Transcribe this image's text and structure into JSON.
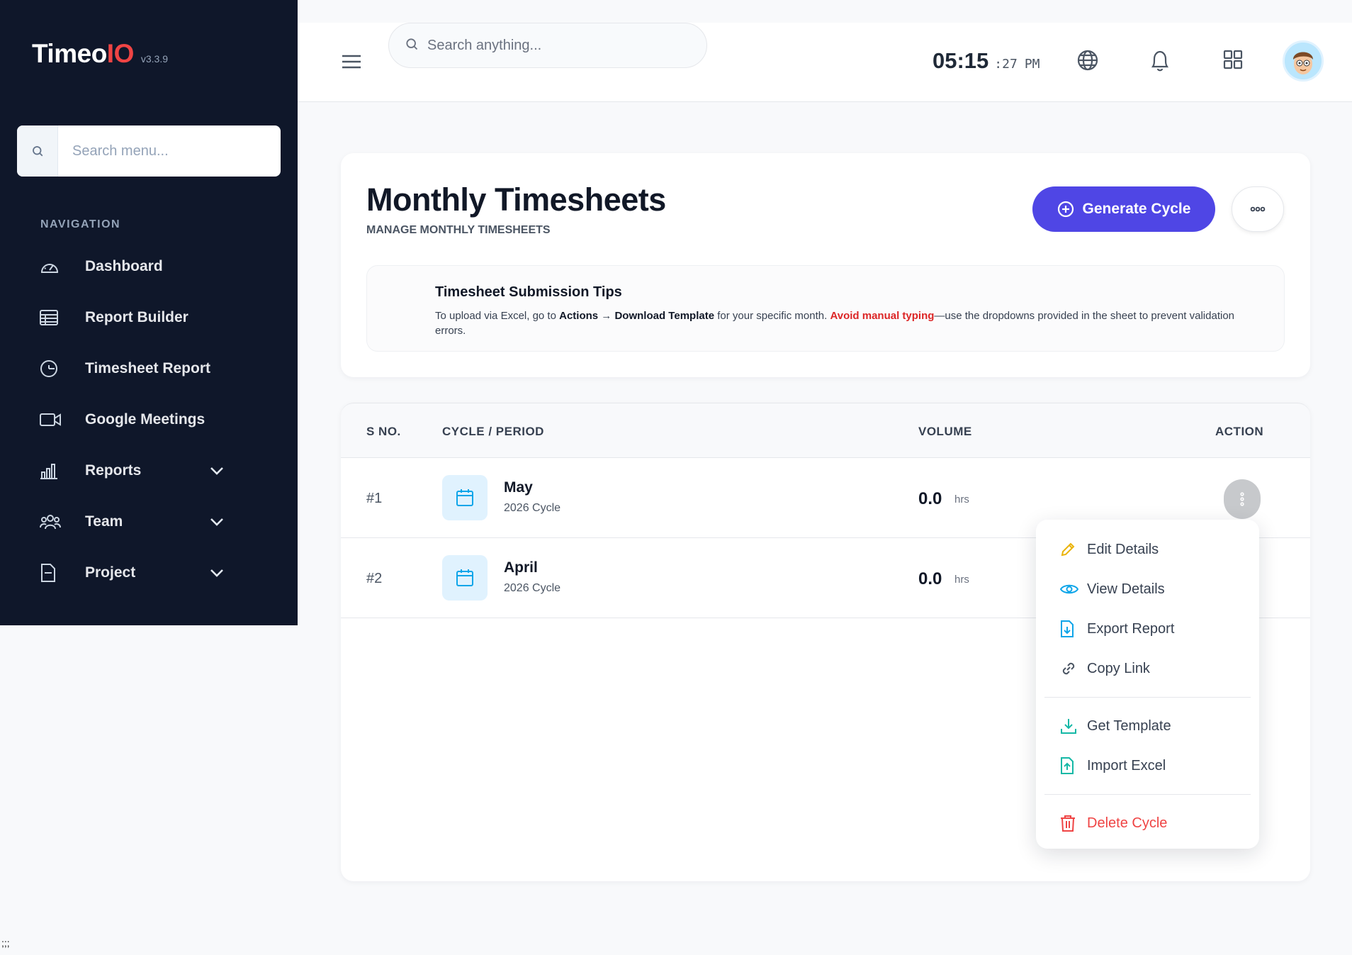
{
  "app": {
    "name_main": "Timeo",
    "name_accent": "IO",
    "version": "v3.3.9"
  },
  "sidebar": {
    "search_placeholder": "Search menu...",
    "nav_heading": "NAVIGATION",
    "items": [
      {
        "label": "Dashboard",
        "icon": "speedometer-icon"
      },
      {
        "label": "Report Builder",
        "icon": "table-icon"
      },
      {
        "label": "Timesheet Report",
        "icon": "clock-report-icon"
      },
      {
        "label": "Google Meetings",
        "icon": "video-camera-icon"
      },
      {
        "label": "Reports",
        "icon": "bar-chart-icon",
        "expandable": true
      },
      {
        "label": "Team",
        "icon": "users-icon",
        "expandable": true
      },
      {
        "label": "Project",
        "icon": "document-icon",
        "expandable": true
      }
    ]
  },
  "topbar": {
    "search_placeholder": "Search anything...",
    "clock_hm": "05:15",
    "clock_sec": ":27",
    "clock_ampm": "PM"
  },
  "header": {
    "title": "Monthly Timesheets",
    "subtitle": "MANAGE MONTHLY TIMESHEETS",
    "generate_label": "Generate Cycle"
  },
  "tips": {
    "title": "Timesheet Submission Tips",
    "text_1": "To upload via Excel, go to ",
    "bold_1": "Actions",
    "arrow": " → ",
    "bold_2": "Download Template",
    "text_2": " for your specific month. ",
    "warn": "Avoid manual typing",
    "text_3": "—use the dropdowns provided in the sheet to prevent validation errors."
  },
  "table": {
    "columns": [
      "S NO.",
      "CYCLE / PERIOD",
      "VOLUME",
      "ACTION"
    ],
    "rows": [
      {
        "sno": "#1",
        "month": "May",
        "cycle": "2026 Cycle",
        "volume": "0.0",
        "unit": "hrs"
      },
      {
        "sno": "#2",
        "month": "April",
        "cycle": "2026 Cycle",
        "volume": "0.0",
        "unit": "hrs"
      }
    ]
  },
  "dropdown": {
    "items": [
      {
        "label": "Edit Details",
        "icon": "pencil-icon"
      },
      {
        "label": "View Details",
        "icon": "eye-icon"
      },
      {
        "label": "Export Report",
        "icon": "file-download-icon"
      },
      {
        "label": "Copy Link",
        "icon": "link-icon"
      },
      {
        "label": "Get Template",
        "icon": "download-tray-icon"
      },
      {
        "label": "Import Excel",
        "icon": "file-upload-icon"
      },
      {
        "label": "Delete Cycle",
        "icon": "trash-icon"
      }
    ]
  },
  "colors": {
    "sidebar_bg": "#0f172a",
    "accent": "#4f46e5",
    "danger": "#ef4444",
    "info": "#0ea5e9"
  },
  "footer_text": ";;;"
}
